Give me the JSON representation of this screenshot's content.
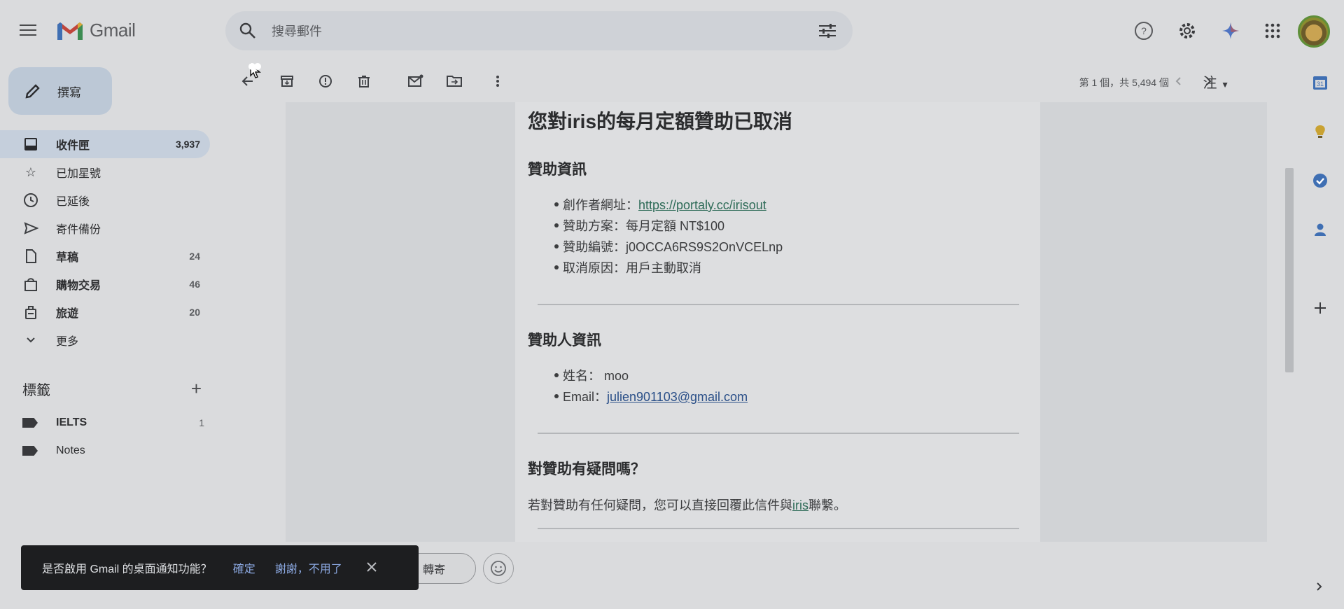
{
  "app": {
    "name": "Gmail"
  },
  "search": {
    "placeholder": "搜尋郵件"
  },
  "compose": {
    "label": "撰寫"
  },
  "nav": [
    {
      "label": "收件匣",
      "count": "3,937",
      "icon": "inbox-icon",
      "active": true
    },
    {
      "label": "已加星號",
      "count": "",
      "icon": "star-icon"
    },
    {
      "label": "已延後",
      "count": "",
      "icon": "clock-icon"
    },
    {
      "label": "寄件備份",
      "count": "",
      "icon": "send-icon"
    },
    {
      "label": "草稿",
      "count": "24",
      "icon": "draft-icon"
    },
    {
      "label": "購物交易",
      "count": "46",
      "icon": "shopping-icon"
    },
    {
      "label": "旅遊",
      "count": "20",
      "icon": "travel-icon"
    },
    {
      "label": "更多",
      "count": "",
      "icon": "chevron-down-icon"
    }
  ],
  "labels": {
    "heading": "標籤",
    "items": [
      {
        "label": "IELTS",
        "count": "1"
      },
      {
        "label": "Notes",
        "count": ""
      }
    ]
  },
  "toolbar": {
    "pager": "第 1 個，共 5,494 個",
    "lang": "注"
  },
  "email": {
    "title": "您對iris的每月定額贊助已取消",
    "section1": {
      "heading": "贊助資訊",
      "creator_label": "創作者網址：",
      "creator_link": "https://portaly.cc/irisout",
      "plan": "贊助方案：每月定額 NT$100",
      "id": "贊助編號：j0OCCA6RS9S2OnVCELnp",
      "reason": "取消原因：用戶主動取消"
    },
    "section2": {
      "heading": "贊助人資訊",
      "name": "姓名： moo",
      "email_label": "Email：",
      "email_link": "julien901103@gmail.com"
    },
    "section3": {
      "heading": "對贊助有疑問嗎？",
      "para_before": "若對贊助有任何疑問，您可以直接回覆此信件與",
      "para_link": "iris",
      "para_after": "聯繫。"
    }
  },
  "snackbar": {
    "text": "是否啟用 Gmail 的桌面通知功能？",
    "ok": "確定",
    "no": "謝謝，不用了"
  },
  "actions": {
    "forward": "轉寄"
  },
  "colors": {
    "accent": "#1a73e8",
    "link": "#2c6a56"
  }
}
